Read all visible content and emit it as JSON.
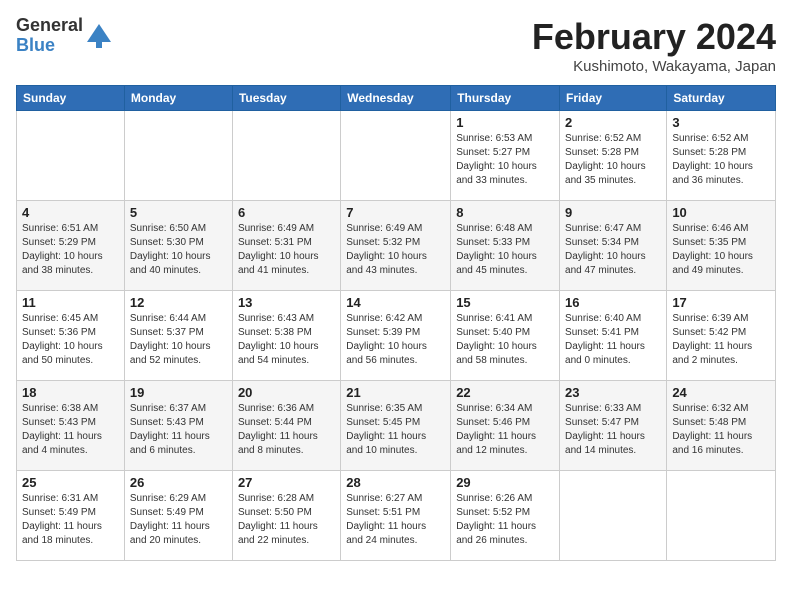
{
  "logo": {
    "general": "General",
    "blue": "Blue"
  },
  "title": "February 2024",
  "subtitle": "Kushimoto, Wakayama, Japan",
  "weekdays": [
    "Sunday",
    "Monday",
    "Tuesday",
    "Wednesday",
    "Thursday",
    "Friday",
    "Saturday"
  ],
  "weeks": [
    [
      {
        "day": "",
        "info": ""
      },
      {
        "day": "",
        "info": ""
      },
      {
        "day": "",
        "info": ""
      },
      {
        "day": "",
        "info": ""
      },
      {
        "day": "1",
        "info": "Sunrise: 6:53 AM\nSunset: 5:27 PM\nDaylight: 10 hours\nand 33 minutes."
      },
      {
        "day": "2",
        "info": "Sunrise: 6:52 AM\nSunset: 5:28 PM\nDaylight: 10 hours\nand 35 minutes."
      },
      {
        "day": "3",
        "info": "Sunrise: 6:52 AM\nSunset: 5:28 PM\nDaylight: 10 hours\nand 36 minutes."
      }
    ],
    [
      {
        "day": "4",
        "info": "Sunrise: 6:51 AM\nSunset: 5:29 PM\nDaylight: 10 hours\nand 38 minutes."
      },
      {
        "day": "5",
        "info": "Sunrise: 6:50 AM\nSunset: 5:30 PM\nDaylight: 10 hours\nand 40 minutes."
      },
      {
        "day": "6",
        "info": "Sunrise: 6:49 AM\nSunset: 5:31 PM\nDaylight: 10 hours\nand 41 minutes."
      },
      {
        "day": "7",
        "info": "Sunrise: 6:49 AM\nSunset: 5:32 PM\nDaylight: 10 hours\nand 43 minutes."
      },
      {
        "day": "8",
        "info": "Sunrise: 6:48 AM\nSunset: 5:33 PM\nDaylight: 10 hours\nand 45 minutes."
      },
      {
        "day": "9",
        "info": "Sunrise: 6:47 AM\nSunset: 5:34 PM\nDaylight: 10 hours\nand 47 minutes."
      },
      {
        "day": "10",
        "info": "Sunrise: 6:46 AM\nSunset: 5:35 PM\nDaylight: 10 hours\nand 49 minutes."
      }
    ],
    [
      {
        "day": "11",
        "info": "Sunrise: 6:45 AM\nSunset: 5:36 PM\nDaylight: 10 hours\nand 50 minutes."
      },
      {
        "day": "12",
        "info": "Sunrise: 6:44 AM\nSunset: 5:37 PM\nDaylight: 10 hours\nand 52 minutes."
      },
      {
        "day": "13",
        "info": "Sunrise: 6:43 AM\nSunset: 5:38 PM\nDaylight: 10 hours\nand 54 minutes."
      },
      {
        "day": "14",
        "info": "Sunrise: 6:42 AM\nSunset: 5:39 PM\nDaylight: 10 hours\nand 56 minutes."
      },
      {
        "day": "15",
        "info": "Sunrise: 6:41 AM\nSunset: 5:40 PM\nDaylight: 10 hours\nand 58 minutes."
      },
      {
        "day": "16",
        "info": "Sunrise: 6:40 AM\nSunset: 5:41 PM\nDaylight: 11 hours\nand 0 minutes."
      },
      {
        "day": "17",
        "info": "Sunrise: 6:39 AM\nSunset: 5:42 PM\nDaylight: 11 hours\nand 2 minutes."
      }
    ],
    [
      {
        "day": "18",
        "info": "Sunrise: 6:38 AM\nSunset: 5:43 PM\nDaylight: 11 hours\nand 4 minutes."
      },
      {
        "day": "19",
        "info": "Sunrise: 6:37 AM\nSunset: 5:43 PM\nDaylight: 11 hours\nand 6 minutes."
      },
      {
        "day": "20",
        "info": "Sunrise: 6:36 AM\nSunset: 5:44 PM\nDaylight: 11 hours\nand 8 minutes."
      },
      {
        "day": "21",
        "info": "Sunrise: 6:35 AM\nSunset: 5:45 PM\nDaylight: 11 hours\nand 10 minutes."
      },
      {
        "day": "22",
        "info": "Sunrise: 6:34 AM\nSunset: 5:46 PM\nDaylight: 11 hours\nand 12 minutes."
      },
      {
        "day": "23",
        "info": "Sunrise: 6:33 AM\nSunset: 5:47 PM\nDaylight: 11 hours\nand 14 minutes."
      },
      {
        "day": "24",
        "info": "Sunrise: 6:32 AM\nSunset: 5:48 PM\nDaylight: 11 hours\nand 16 minutes."
      }
    ],
    [
      {
        "day": "25",
        "info": "Sunrise: 6:31 AM\nSunset: 5:49 PM\nDaylight: 11 hours\nand 18 minutes."
      },
      {
        "day": "26",
        "info": "Sunrise: 6:29 AM\nSunset: 5:49 PM\nDaylight: 11 hours\nand 20 minutes."
      },
      {
        "day": "27",
        "info": "Sunrise: 6:28 AM\nSunset: 5:50 PM\nDaylight: 11 hours\nand 22 minutes."
      },
      {
        "day": "28",
        "info": "Sunrise: 6:27 AM\nSunset: 5:51 PM\nDaylight: 11 hours\nand 24 minutes."
      },
      {
        "day": "29",
        "info": "Sunrise: 6:26 AM\nSunset: 5:52 PM\nDaylight: 11 hours\nand 26 minutes."
      },
      {
        "day": "",
        "info": ""
      },
      {
        "day": "",
        "info": ""
      }
    ]
  ]
}
